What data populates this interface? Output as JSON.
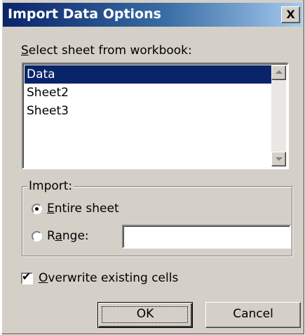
{
  "dialog": {
    "title": "Import Data Options",
    "close_glyph": "X"
  },
  "sheet_select": {
    "label_access": "S",
    "label_rest": "elect sheet from workbook:",
    "sheets": [
      "Data",
      "Sheet2",
      "Sheet3"
    ],
    "selected": "Data"
  },
  "import_group": {
    "title": "Import:",
    "options": [
      {
        "access": "E",
        "rest": "ntire sheet",
        "checked": true
      },
      {
        "pre": "R",
        "access": "a",
        "rest": "nge:",
        "checked": false
      }
    ],
    "range_value": ""
  },
  "overwrite": {
    "access": "O",
    "rest": "verwrite existing cells",
    "checked": true
  },
  "buttons": {
    "ok": "OK",
    "cancel": "Cancel"
  },
  "icons": {
    "scroll_up": "scroll-up-arrow-icon",
    "scroll_down": "scroll-down-arrow-icon",
    "radio_checked": "radio-selected-icon",
    "checkbox_checked": "checkmark-icon"
  }
}
